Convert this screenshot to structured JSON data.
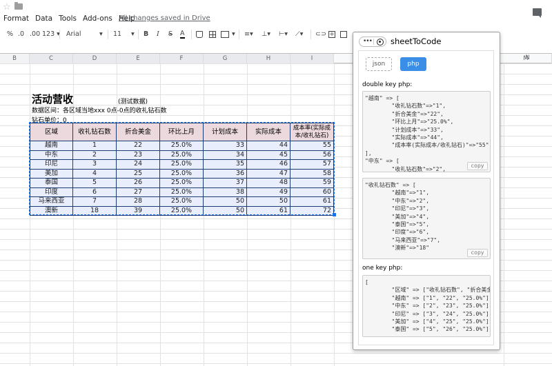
{
  "topbar": {
    "menu": [
      "Format",
      "Data",
      "Tools",
      "Add-ons",
      "Help"
    ],
    "saved_status": "All changes saved in Drive"
  },
  "toolbar": {
    "percent": "%",
    "decrease_decimal": ".0",
    "increase_decimal": ".00",
    "number_format": "123",
    "font": "Arial",
    "font_size": "11",
    "bold": "B",
    "italic": "I",
    "strikethrough": "S",
    "text_color": "A"
  },
  "columns": [
    "B",
    "C",
    "D",
    "E",
    "F",
    "G",
    "H",
    "I",
    "M",
    "N"
  ],
  "sheet": {
    "title": "活动营收",
    "note": "(测试数据)",
    "range_text": "数据区间：各区域当地xxx 0点-0点的收礼钻石数",
    "unit_text": "钻石单价：0"
  },
  "table": {
    "headers": [
      "区域",
      "收礼钻石数",
      "折合美金",
      "环比上月",
      "计划成本",
      "实际成本",
      "成本率(实际成本/收礼钻石)"
    ],
    "rows": [
      [
        "越南",
        "1",
        "22",
        "25.0%",
        "33",
        "44",
        "55"
      ],
      [
        "中东",
        "2",
        "23",
        "25.0%",
        "34",
        "45",
        "56"
      ],
      [
        "印尼",
        "3",
        "24",
        "25.0%",
        "35",
        "46",
        "57"
      ],
      [
        "美加",
        "4",
        "25",
        "25.0%",
        "36",
        "47",
        "58"
      ],
      [
        "泰国",
        "5",
        "26",
        "25.0%",
        "37",
        "48",
        "59"
      ],
      [
        "印度",
        "6",
        "27",
        "25.0%",
        "38",
        "49",
        "60"
      ],
      [
        "马来西亚",
        "7",
        "28",
        "25.0%",
        "50",
        "50",
        "61"
      ],
      [
        "澳新",
        "18",
        "39",
        "25.0%",
        "50",
        "61",
        "72"
      ]
    ]
  },
  "panel": {
    "title": "sheetToCode",
    "btn_json": "json",
    "btn_php": "php",
    "label_double": "double key php:",
    "label_one": "one key php:",
    "copy": "copy",
    "code_double1": "\"越南\" => [\n        \"收礼钻石数\"=>\"1\",\n        \"折合美金\"=>\"22\",\n        \"环比上月\"=>\"25.0%\",\n        \"计划成本\"=>\"33\",\n        \"实际成本\"=>\"44\",\n        \"成本率(实际成本/收礼钻石)\"=>\"55\"\n],\n\"中东\" => [\n        \"收礼钻石数\"=>\"2\",",
    "code_double2": "\"收礼钻石数\" => [\n        \"越南\"=>\"1\",\n        \"中东\"=>\"2\",\n        \"印尼\"=>\"3\",\n        \"美加\"=>\"4\",\n        \"泰国\"=>\"5\",\n        \"印度\"=>\"6\",\n        \"马来西亚\"=>\"7\",\n        \"澳新\"=>\"18\"",
    "code_one": "[\n        \"区域\" => [\"收礼钻石数\", \"折合美金\"],\n        \"越南\" => [\"1\", \"22\", \"25.0%\"],\n        \"中东\" => [\"2\", \"23\", \"25.0%\"],\n        \"印尼\" => [\"3\", \"24\", \"25.0%\"],\n        \"美加\" => [\"4\", \"25\", \"25.0%\"],\n        \"泰国\" => [\"5\", \"26\", \"25.0%\"]"
  }
}
